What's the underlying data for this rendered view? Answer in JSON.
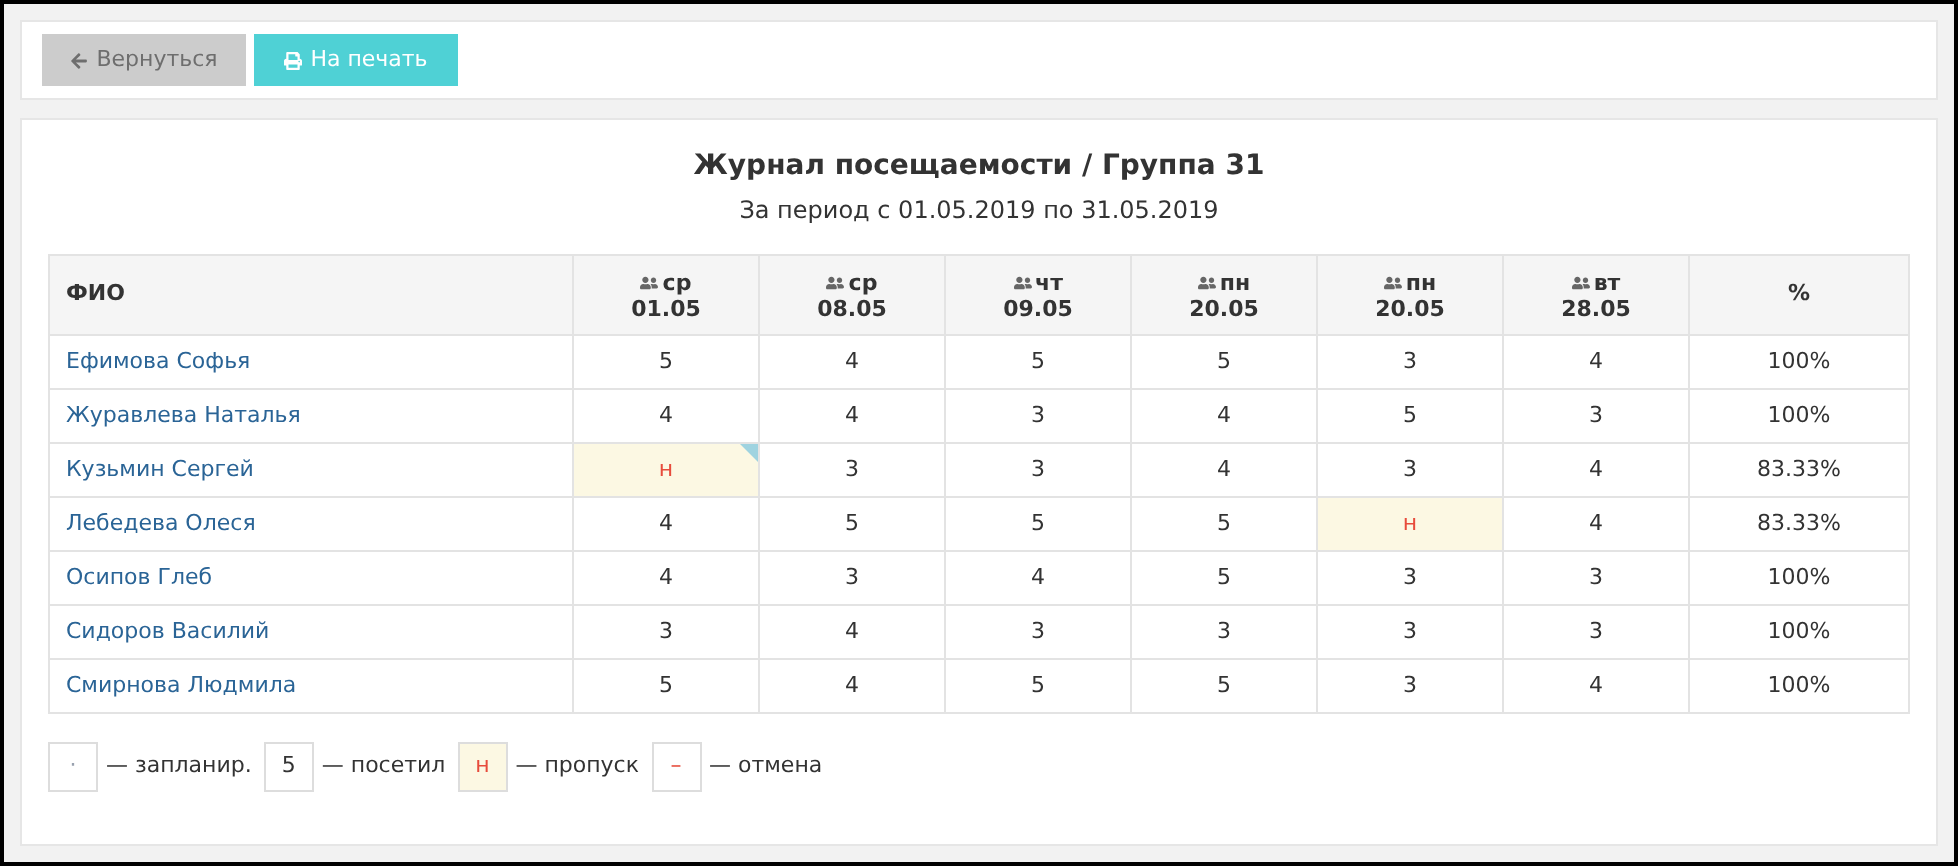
{
  "toolbar": {
    "buttons": [
      {
        "label": "Вернуться",
        "kind": "back",
        "disabled": true
      },
      {
        "label": "На печать",
        "kind": "print",
        "disabled": false
      }
    ]
  },
  "report": {
    "title": "Журнал посещаемости / Группа 31",
    "subtitle": "За период с 01.05.2019 по 31.05.2019"
  },
  "table": {
    "name_header": "ФИО",
    "percent_header": "%",
    "columns": [
      {
        "weekday": "ср",
        "date": "01.05"
      },
      {
        "weekday": "ср",
        "date": "08.05"
      },
      {
        "weekday": "чт",
        "date": "09.05"
      },
      {
        "weekday": "пн",
        "date": "20.05"
      },
      {
        "weekday": "пн",
        "date": "20.05"
      },
      {
        "weekday": "вт",
        "date": "28.05"
      }
    ],
    "rows": [
      {
        "name": "Ефимова Софья",
        "percent": "100%",
        "cells": [
          {
            "kind": "grade",
            "value": "5",
            "flagged": false
          },
          {
            "kind": "grade",
            "value": "4",
            "flagged": false
          },
          {
            "kind": "grade",
            "value": "5",
            "flagged": false
          },
          {
            "kind": "grade",
            "value": "5",
            "flagged": false
          },
          {
            "kind": "grade",
            "value": "3",
            "flagged": false
          },
          {
            "kind": "grade",
            "value": "4",
            "flagged": false
          }
        ]
      },
      {
        "name": "Журавлева Наталья",
        "percent": "100%",
        "cells": [
          {
            "kind": "grade",
            "value": "4",
            "flagged": false
          },
          {
            "kind": "grade",
            "value": "4",
            "flagged": false
          },
          {
            "kind": "grade",
            "value": "3",
            "flagged": false
          },
          {
            "kind": "grade",
            "value": "4",
            "flagged": false
          },
          {
            "kind": "grade",
            "value": "5",
            "flagged": false
          },
          {
            "kind": "grade",
            "value": "3",
            "flagged": false
          }
        ]
      },
      {
        "name": "Кузьмин Сергей",
        "percent": "83.33%",
        "cells": [
          {
            "kind": "absent",
            "value": "н",
            "flagged": true
          },
          {
            "kind": "grade",
            "value": "3",
            "flagged": false
          },
          {
            "kind": "grade",
            "value": "3",
            "flagged": false
          },
          {
            "kind": "grade",
            "value": "4",
            "flagged": false
          },
          {
            "kind": "grade",
            "value": "3",
            "flagged": false
          },
          {
            "kind": "grade",
            "value": "4",
            "flagged": false
          }
        ]
      },
      {
        "name": "Лебедева Олеся",
        "percent": "83.33%",
        "cells": [
          {
            "kind": "grade",
            "value": "4",
            "flagged": false
          },
          {
            "kind": "grade",
            "value": "5",
            "flagged": false
          },
          {
            "kind": "grade",
            "value": "5",
            "flagged": false
          },
          {
            "kind": "grade",
            "value": "5",
            "flagged": false
          },
          {
            "kind": "absent",
            "value": "н",
            "flagged": false
          },
          {
            "kind": "grade",
            "value": "4",
            "flagged": false
          }
        ]
      },
      {
        "name": "Осипов Глеб",
        "percent": "100%",
        "cells": [
          {
            "kind": "grade",
            "value": "4",
            "flagged": false
          },
          {
            "kind": "grade",
            "value": "3",
            "flagged": false
          },
          {
            "kind": "grade",
            "value": "4",
            "flagged": false
          },
          {
            "kind": "grade",
            "value": "5",
            "flagged": false
          },
          {
            "kind": "grade",
            "value": "3",
            "flagged": false
          },
          {
            "kind": "grade",
            "value": "3",
            "flagged": false
          }
        ]
      },
      {
        "name": "Сидоров Василий",
        "percent": "100%",
        "cells": [
          {
            "kind": "grade",
            "value": "3",
            "flagged": false
          },
          {
            "kind": "grade",
            "value": "4",
            "flagged": false
          },
          {
            "kind": "grade",
            "value": "3",
            "flagged": false
          },
          {
            "kind": "grade",
            "value": "3",
            "flagged": false
          },
          {
            "kind": "grade",
            "value": "3",
            "flagged": false
          },
          {
            "kind": "grade",
            "value": "3",
            "flagged": false
          }
        ]
      },
      {
        "name": "Смирнова Людмила",
        "percent": "100%",
        "cells": [
          {
            "kind": "grade",
            "value": "5",
            "flagged": false
          },
          {
            "kind": "grade",
            "value": "4",
            "flagged": false
          },
          {
            "kind": "grade",
            "value": "5",
            "flagged": false
          },
          {
            "kind": "grade",
            "value": "5",
            "flagged": false
          },
          {
            "kind": "grade",
            "value": "3",
            "flagged": false
          },
          {
            "kind": "grade",
            "value": "4",
            "flagged": false
          }
        ]
      }
    ]
  },
  "legend": [
    {
      "kind": "planned",
      "sample": "·",
      "label": "— запланир."
    },
    {
      "kind": "grade",
      "sample": "5",
      "label": "— посетил"
    },
    {
      "kind": "absent",
      "sample": "н",
      "label": "— пропуск"
    },
    {
      "kind": "cancelled",
      "sample": "–",
      "label": "— отмена"
    }
  ]
}
